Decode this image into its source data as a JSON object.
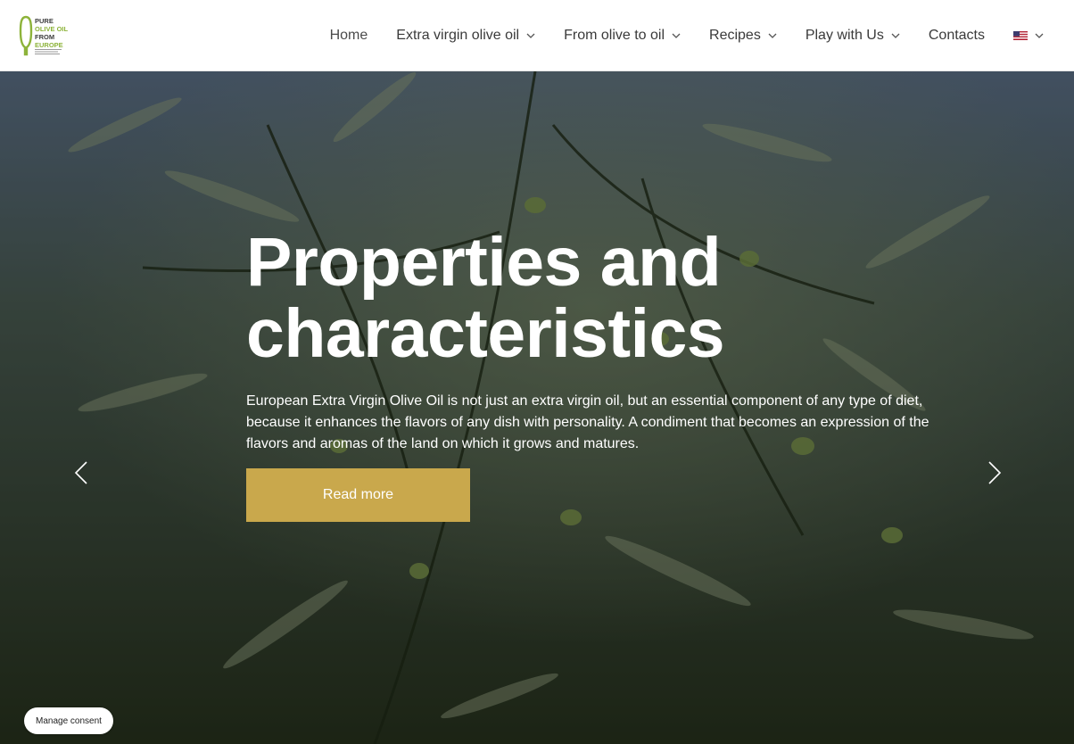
{
  "brand": {
    "logo_lines": [
      "PURE",
      "OLIVE OIL",
      "FROM",
      "EUROPE"
    ]
  },
  "nav": {
    "items": [
      {
        "label": "Home",
        "has_dropdown": false,
        "active": true
      },
      {
        "label": "Extra virgin olive oil",
        "has_dropdown": true
      },
      {
        "label": "From olive to oil",
        "has_dropdown": true
      },
      {
        "label": "Recipes",
        "has_dropdown": true
      },
      {
        "label": "Play with Us",
        "has_dropdown": true
      },
      {
        "label": "Contacts",
        "has_dropdown": false
      }
    ],
    "language_icon": "us-flag-icon"
  },
  "hero": {
    "title_line1": "Properties and",
    "title_line2": "characteristics",
    "text": "European Extra Virgin Olive Oil is not just an extra virgin oil, but an essential component of any type of diet, because it enhances the flavors of any dish with personality. A condiment that becomes an expression of the flavors and aromas of the land on which it grows and matures.",
    "button_label": "Read more"
  },
  "consent": {
    "label": "Manage consent"
  },
  "colors": {
    "accent": "#c9a84c",
    "logo_green": "#8db33a",
    "nav_text": "#3a3a3a"
  }
}
